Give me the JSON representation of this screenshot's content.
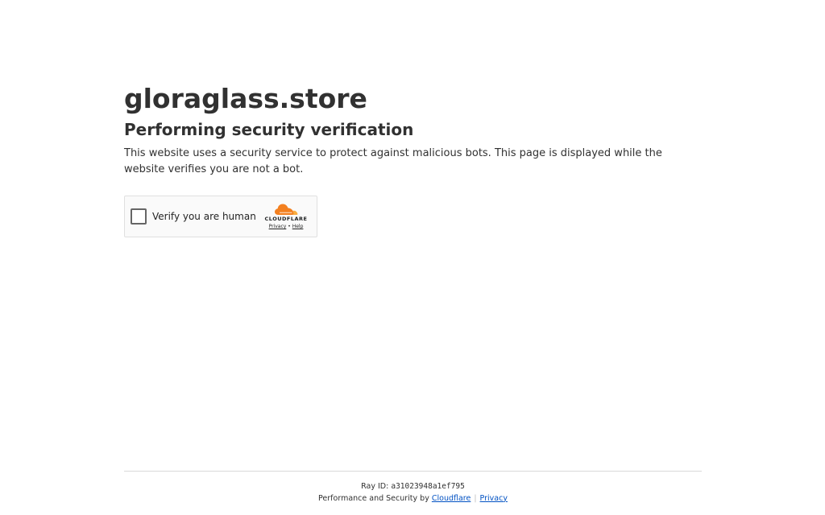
{
  "page": {
    "site_name": "gloraglass.store",
    "heading": "Performing security verification",
    "description": "This website uses a security service to protect against malicious bots. This page is displayed while the website verifies you are not a bot."
  },
  "widget": {
    "checkbox_label": "Verify you are human",
    "brand_logo": "cloudflare-cloud-icon",
    "brand_name": "CLOUDFLARE",
    "privacy_link": "Privacy",
    "link_separator": "•",
    "help_link": "Help",
    "checked": false
  },
  "footer": {
    "ray_label": "Ray ID:",
    "ray_id": "a31023948a1ef795",
    "performance_text": "Performance and Security by",
    "cloudflare_link": "Cloudflare",
    "separator": "|",
    "privacy_link": "Privacy"
  },
  "colors": {
    "text": "#313131",
    "link": "#0051c3",
    "brand_orange": "#f38020",
    "brand_orange_light": "#faae40"
  }
}
